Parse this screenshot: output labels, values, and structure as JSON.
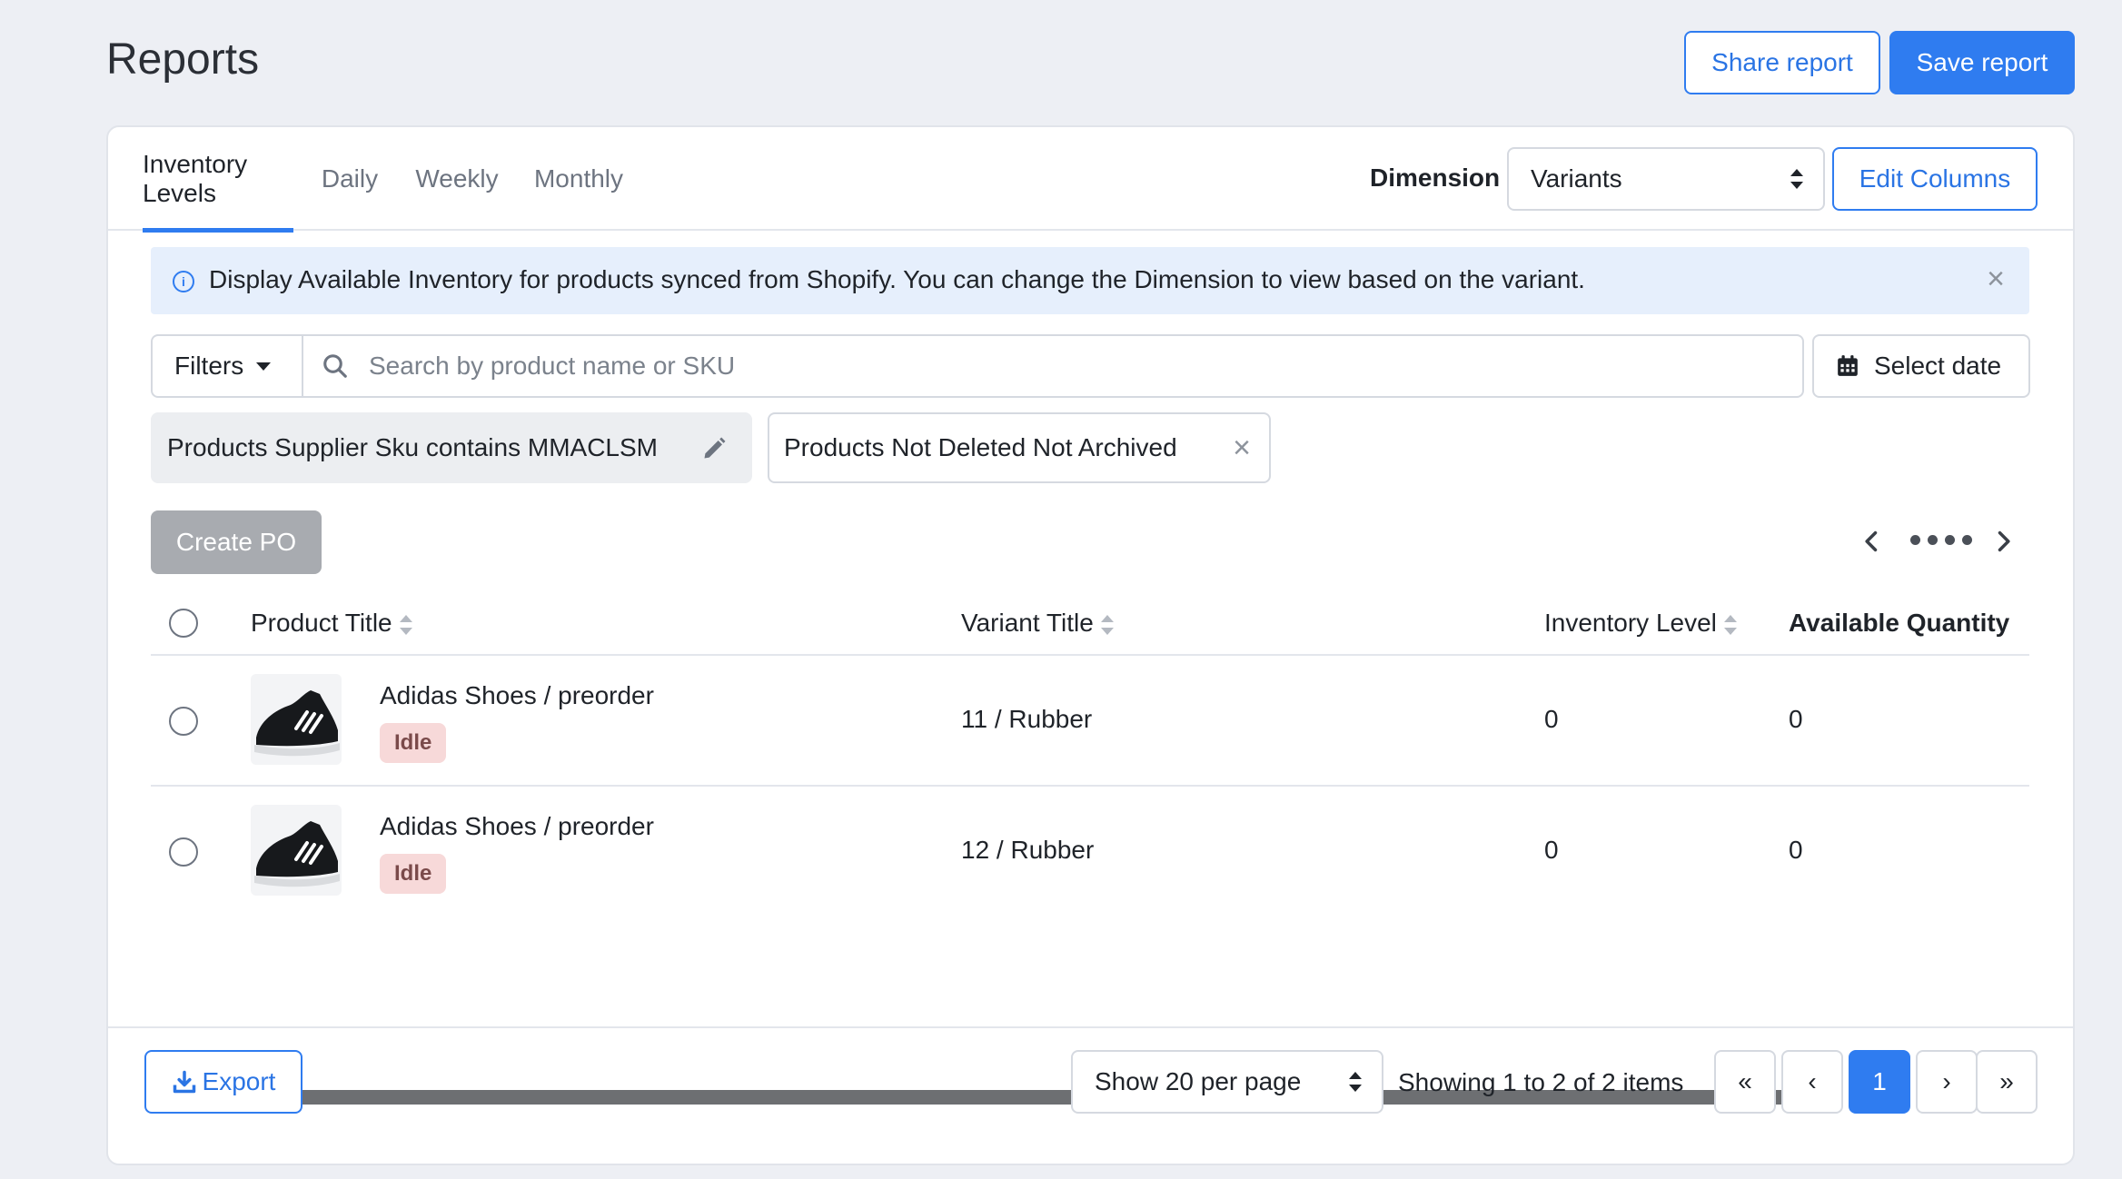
{
  "page": {
    "title": "Reports"
  },
  "header": {
    "share_label": "Share report",
    "save_label": "Save report"
  },
  "tabs": [
    {
      "label": "Inventory Levels",
      "active": true
    },
    {
      "label": "Daily",
      "active": false
    },
    {
      "label": "Weekly",
      "active": false
    },
    {
      "label": "Monthly",
      "active": false
    }
  ],
  "dimension": {
    "label": "Dimension",
    "value": "Variants"
  },
  "edit_columns_label": "Edit Columns",
  "banner": {
    "text": "Display Available Inventory for products synced from Shopify. You can change the Dimension to view based on the variant."
  },
  "filters": {
    "button_label": "Filters",
    "search_placeholder": "Search by product name or SKU",
    "date_label": "Select date",
    "chips": [
      "Products Supplier Sku contains MMACLSM",
      "Products Not Deleted Not Archived"
    ]
  },
  "create_po_label": "Create PO",
  "table": {
    "columns": [
      "Product Title",
      "Variant Title",
      "Inventory Level",
      "Available Quantity"
    ],
    "rows": [
      {
        "product": "Adidas Shoes / preorder",
        "badge": "Idle",
        "variant": "11 / Rubber",
        "inventory": "0",
        "available": "0"
      },
      {
        "product": "Adidas Shoes / preorder",
        "badge": "Idle",
        "variant": "12 / Rubber",
        "inventory": "0",
        "available": "0"
      }
    ]
  },
  "footer": {
    "export_label": "Export",
    "per_page": "Show 20 per page",
    "showing": "Showing 1 to 2 of 2 items",
    "pagination": {
      "first": "«",
      "prev": "‹",
      "current": "1",
      "next": "›",
      "last": "»"
    }
  },
  "colors": {
    "accent": "#2f7cf0",
    "badge_bg": "#f7d9d9",
    "background": "#edeff4"
  }
}
